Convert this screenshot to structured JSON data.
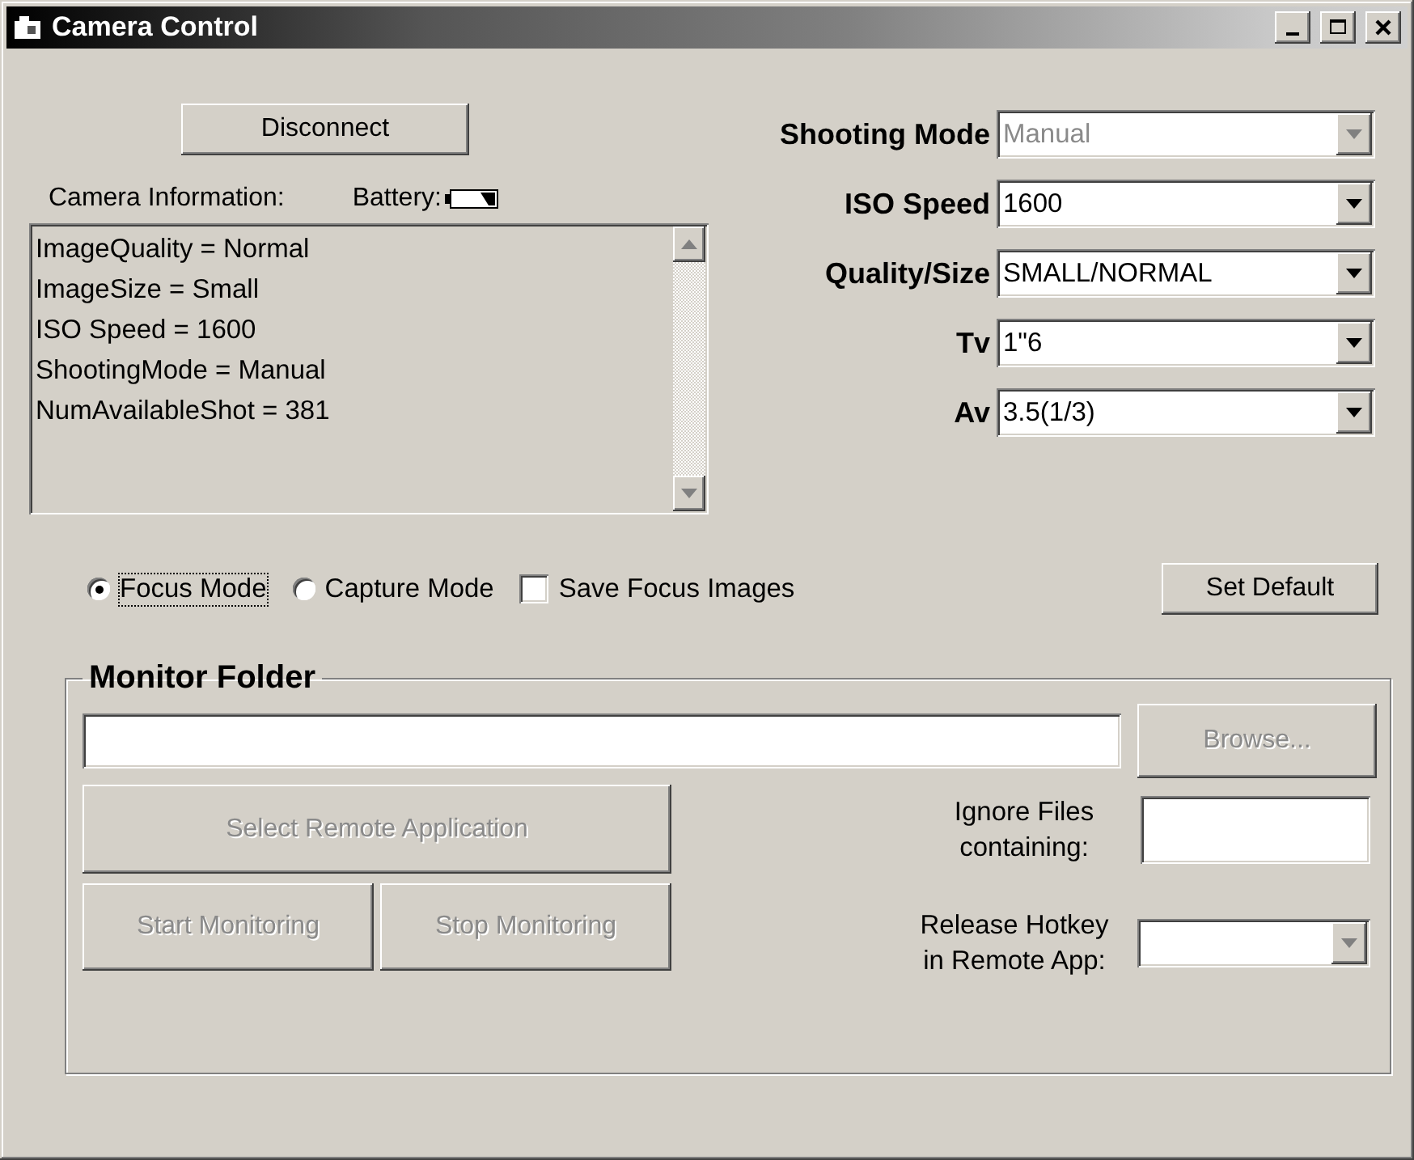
{
  "window": {
    "title": "Camera Control"
  },
  "disconnect_button": "Disconnect",
  "camera_information": {
    "label": "Camera Information:",
    "battery_label": "Battery:",
    "lines": [
      "ImageQuality = Normal",
      "ImageSize = Small",
      "ISO Speed = 1600",
      "ShootingMode = Manual",
      "NumAvailableShot = 381"
    ]
  },
  "settings": [
    {
      "label": "Shooting Mode",
      "value": "Manual",
      "disabled": true
    },
    {
      "label": "ISO Speed",
      "value": "1600",
      "disabled": false
    },
    {
      "label": "Quality/Size",
      "value": "SMALL/NORMAL",
      "disabled": false
    },
    {
      "label": "Tv",
      "value": "1\"6",
      "disabled": false
    },
    {
      "label": "Av",
      "value": "3.5(1/3)",
      "disabled": false
    }
  ],
  "modes": [
    {
      "label": "Focus Mode",
      "selected": true
    },
    {
      "label": "Capture Mode",
      "selected": false
    }
  ],
  "save_focus_images": {
    "label": "Save Focus Images",
    "checked": false
  },
  "set_default_button": "Set Default",
  "monitor_folder": {
    "title": "Monitor Folder",
    "browse_button": {
      "label": "Browse...",
      "disabled": true
    },
    "select_button": {
      "label": "Select Remote Application",
      "disabled": true
    },
    "monitor_buttons": [
      {
        "label": "Start Monitoring",
        "disabled": true
      },
      {
        "label": "Stop Monitoring",
        "disabled": true
      }
    ],
    "ignore_files_label": "Ignore Files containing:",
    "release_hotkey": {
      "label": "Release Hotkey in Remote App:",
      "disabled": true
    }
  }
}
